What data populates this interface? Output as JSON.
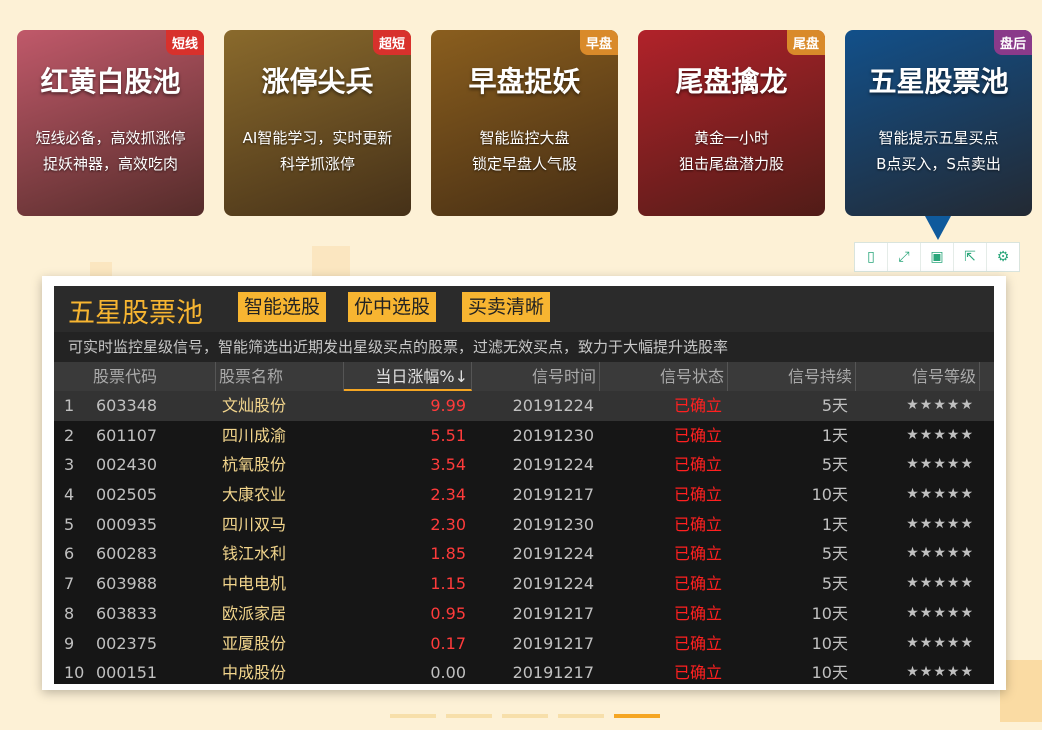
{
  "cards": [
    {
      "tag": "短线",
      "tag_color": "#d8312c",
      "title": "红黄白股池",
      "desc1": "短线必备，高效抓涨停",
      "desc2": "捉妖神器，高效吃肉",
      "bg": "#c0596a"
    },
    {
      "tag": "超短",
      "tag_color": "#d8312c",
      "title": "涨停尖兵",
      "desc1": "AI智能学习，实时更新",
      "desc2": "科学抓涨停",
      "bg": "#8a6a2c"
    },
    {
      "tag": "早盘",
      "tag_color": "#d98a2a",
      "title": "早盘捉妖",
      "desc1": "智能监控大盘",
      "desc2": "锁定早盘人气股",
      "bg": "#8a5e1e"
    },
    {
      "tag": "尾盘",
      "tag_color": "#d98a2a",
      "title": "尾盘擒龙",
      "desc1": "黄金一小时",
      "desc2": "狙击尾盘潜力股",
      "bg": "#b1222a"
    },
    {
      "tag": "盘后",
      "tag_color": "#8a3a8a",
      "title": "五星股票池",
      "desc1": "智能提示五星买点",
      "desc2": "B点买入，S点卖出",
      "bg": "#12508a"
    }
  ],
  "toolbar": [
    {
      "icon": "phone-icon",
      "glyph": "▯"
    },
    {
      "icon": "fullscreen-icon",
      "glyph": "⤢"
    },
    {
      "icon": "save-icon",
      "glyph": "▣"
    },
    {
      "icon": "share-icon",
      "glyph": "⇱"
    },
    {
      "icon": "settings-icon",
      "glyph": "⚙"
    }
  ],
  "panel": {
    "title": "五星股票池",
    "buttons": [
      "智能选股",
      "优中选股",
      "买卖清晰"
    ],
    "description": "可实时监控星级信号，智能筛选出近期发出星级买点的股票，过滤无效买点，致力于大幅提升选股率",
    "headers": [
      "股票代码",
      "股票名称",
      "当日涨幅%↓",
      "信号时间",
      "信号状态",
      "信号持续",
      "信号等级"
    ],
    "rows": [
      {
        "num": "1",
        "code": "603348",
        "name": "文灿股份",
        "change": "9.99",
        "time": "20191224",
        "status": "已确立",
        "duration": "5天",
        "level": "★★★★★"
      },
      {
        "num": "2",
        "code": "601107",
        "name": "四川成渝",
        "change": "5.51",
        "time": "20191230",
        "status": "已确立",
        "duration": "1天",
        "level": "★★★★★"
      },
      {
        "num": "3",
        "code": "002430",
        "name": "杭氧股份",
        "change": "3.54",
        "time": "20191224",
        "status": "已确立",
        "duration": "5天",
        "level": "★★★★★"
      },
      {
        "num": "4",
        "code": "002505",
        "name": "大康农业",
        "change": "2.34",
        "time": "20191217",
        "status": "已确立",
        "duration": "10天",
        "level": "★★★★★"
      },
      {
        "num": "5",
        "code": "000935",
        "name": "四川双马",
        "change": "2.30",
        "time": "20191230",
        "status": "已确立",
        "duration": "1天",
        "level": "★★★★★"
      },
      {
        "num": "6",
        "code": "600283",
        "name": "钱江水利",
        "change": "1.85",
        "time": "20191224",
        "status": "已确立",
        "duration": "5天",
        "level": "★★★★★"
      },
      {
        "num": "7",
        "code": "603988",
        "name": "中电电机",
        "change": "1.15",
        "time": "20191224",
        "status": "已确立",
        "duration": "5天",
        "level": "★★★★★"
      },
      {
        "num": "8",
        "code": "603833",
        "name": "欧派家居",
        "change": "0.95",
        "time": "20191217",
        "status": "已确立",
        "duration": "10天",
        "level": "★★★★★"
      },
      {
        "num": "9",
        "code": "002375",
        "name": "亚厦股份",
        "change": "0.17",
        "time": "20191217",
        "status": "已确立",
        "duration": "10天",
        "level": "★★★★★"
      },
      {
        "num": "10",
        "code": "000151",
        "name": "中成股份",
        "change": "0.00",
        "time": "20191217",
        "status": "已确立",
        "duration": "10天",
        "level": "★★★★★"
      }
    ]
  },
  "colors": {
    "up": "#ff3b3b",
    "flat": "#c0c0c0",
    "accent": "#f7b531"
  },
  "carousel_active": 5
}
